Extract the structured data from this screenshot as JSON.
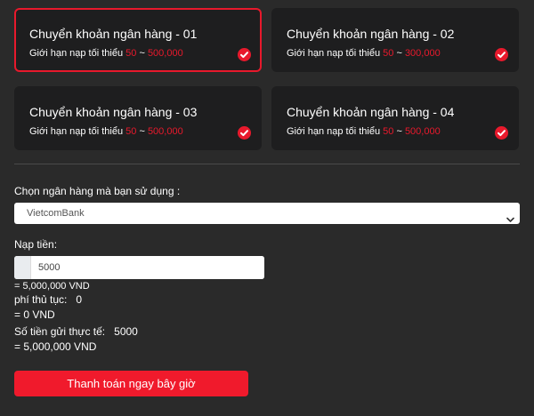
{
  "cards": [
    {
      "title": "Chuyển khoản ngân hàng - 01",
      "limit_label": "Giới hạn nạp tối thiểu",
      "min": "50",
      "sep": "~",
      "max": "500,000",
      "selected": true
    },
    {
      "title": "Chuyển khoản ngân hàng - 02",
      "limit_label": "Giới hạn nạp tối thiểu",
      "min": "50",
      "sep": "~",
      "max": "300,000",
      "selected": false
    },
    {
      "title": "Chuyển khoản ngân hàng - 03",
      "limit_label": "Giới hạn nạp tối thiểu",
      "min": "50",
      "sep": "~",
      "max": "500,000",
      "selected": false
    },
    {
      "title": "Chuyển khoản ngân hàng - 04",
      "limit_label": "Giới hạn nạp tối thiểu",
      "min": "50",
      "sep": "~",
      "max": "500,000",
      "selected": false
    }
  ],
  "bank": {
    "label": "Chọn ngân hàng mà bạn sử dụng :",
    "selected": "VietcomBank"
  },
  "deposit": {
    "label": "Nạp tiền:",
    "value": "5000",
    "converted": "= 5,000,000 VND"
  },
  "fee": {
    "label": "phí thủ tục:",
    "value": "0",
    "converted": "= 0 VND"
  },
  "actual": {
    "label": "Số tiền gửi thực tế:",
    "value": "5000",
    "converted": "= 5,000,000 VND"
  },
  "pay_button": "Thanh toán ngay bây giờ",
  "colors": {
    "accent": "#e8192c",
    "background": "#2a2a2a",
    "card": "#1e1e1f"
  }
}
